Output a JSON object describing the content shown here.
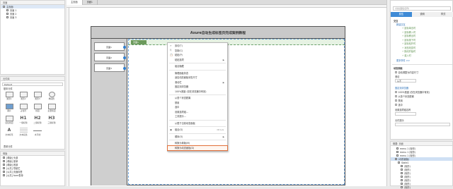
{
  "left": {
    "pages_title": "页面",
    "pages": [
      "主页面",
      "页面 1",
      "页面 2",
      "页面 3"
    ],
    "widgets_title": "元件库",
    "library_select": "Default",
    "section": "基本元件",
    "widgets": [
      {
        "label": "矩形1",
        "icon": "rect"
      },
      {
        "label": "矩形2",
        "icon": "rect"
      },
      {
        "label": "矩形3",
        "icon": "rect"
      },
      {
        "label": "椭圆形",
        "icon": "ellipse"
      },
      {
        "label": "图片",
        "icon": "image"
      },
      {
        "label": "占位符",
        "icon": "rect"
      },
      {
        "label": "按钮",
        "icon": "rect"
      },
      {
        "label": "主要按钮",
        "icon": "rect"
      },
      {
        "label": "链接按钮",
        "icon": "rect"
      },
      {
        "label": "一级标题",
        "icon": "H1"
      },
      {
        "label": "二级标题",
        "icon": "H2"
      },
      {
        "label": "三级标题",
        "icon": "H3"
      },
      {
        "label": "文本标签",
        "icon": "A"
      },
      {
        "label": "文本段落",
        "icon": "para"
      },
      {
        "label": "水平线",
        "icon": "line"
      }
    ],
    "section2": "表单元件",
    "masters_title": "母版",
    "masters": [
      "[母版] 头部",
      "[母版] 菜单",
      "[母版] 底部",
      "[公共] 导航栏",
      "[公共] 页面标签",
      "[公共] form表单"
    ]
  },
  "tabs": [
    {
      "label": "主页面",
      "active": true
    },
    {
      "label": "页面1",
      "active": false
    }
  ],
  "canvas": {
    "title": "Axure自动生成标签页完成案例教程",
    "sidebar_items": [
      "页面1",
      "页面2",
      "页面3"
    ],
    "active_tab": "页面1"
  },
  "context_menu": {
    "items": [
      {
        "label": "剪切(T)",
        "icon": "✂",
        "type": "item"
      },
      {
        "label": "复制(C)",
        "icon": "⎘",
        "type": "item"
      },
      {
        "label": "粘贴(P)",
        "icon": "📋",
        "type": "item"
      },
      {
        "label": "粘贴选项",
        "icon": "",
        "type": "submenu"
      },
      {
        "type": "sep"
      },
      {
        "label": "组合隐藏",
        "icon": "",
        "type": "item"
      },
      {
        "type": "sep"
      },
      {
        "label": "管理面板状态",
        "icon": "",
        "type": "item"
      },
      {
        "label": "适应动态面板状态尺寸",
        "icon": "",
        "type": "item"
      },
      {
        "label": "滚动栏",
        "icon": "",
        "type": "submenu"
      },
      {
        "label": "固定到浏览器",
        "icon": "",
        "type": "item"
      },
      {
        "label": "100%宽度 (仅在浏览器中有效)",
        "icon": "",
        "type": "item"
      },
      {
        "type": "sep"
      },
      {
        "label": "从首个状态脱离",
        "icon": "",
        "type": "item"
      },
      {
        "label": "禁用",
        "icon": "",
        "type": "item"
      },
      {
        "label": "选中",
        "icon": "",
        "type": "item"
      },
      {
        "label": "设置选项组...",
        "icon": "",
        "type": "item"
      },
      {
        "label": "工具提示...",
        "icon": "",
        "type": "item"
      },
      {
        "type": "sep"
      },
      {
        "label": "从属于当前动态面板",
        "icon": "",
        "type": "item"
      },
      {
        "type": "sep"
      },
      {
        "label": "组合(G)",
        "icon": "▣",
        "type": "item",
        "shortcut": "Ctrl+G"
      },
      {
        "type": "sep"
      },
      {
        "label": "顺序(O)",
        "icon": "",
        "type": "submenu"
      },
      {
        "type": "sep"
      },
      {
        "label": "转换为母版(M)",
        "icon": "",
        "type": "item"
      },
      {
        "label": "转换为动态面板(D)",
        "icon": "",
        "type": "item",
        "highlight": true
      }
    ]
  },
  "right": {
    "header": "(动态面板名称)",
    "tabs": [
      "属性",
      "说明",
      "样式"
    ],
    "interactions_label": "交互",
    "new_interaction": "新建交互",
    "events": [
      "鼠标单击时",
      "鼠标移入时",
      "鼠标移出时",
      "鼠标按下时",
      "鼠标松开时",
      "状态改变时",
      "拖动开始时",
      "载入时"
    ],
    "more_events": "更多事件 >>",
    "dynamic_panel": "动态面板",
    "fit_content": "自动调整为内容尺寸",
    "scroll_label": "滚动",
    "scroll_value": "从不",
    "fixed_browser": "固定到浏览器",
    "full_width": "100%宽度 (仅在浏览器中有效)",
    "pin_first": "从首个状态脱离",
    "disabled": "禁用",
    "selected": "选中",
    "set_group": "设置选项组名称",
    "tooltip": "元件提示",
    "outline_header": "概要: 页面",
    "outline": [
      "menu 1 (矩形)",
      "menu 1 (矩形)",
      "menu 1 (矩形)",
      "(动态面板)",
      "State1",
      "(矩形)",
      "(矩形)",
      "(矩形)",
      "(矩形)",
      "(矩形)",
      "(矩形)",
      "(矩形)"
    ]
  }
}
